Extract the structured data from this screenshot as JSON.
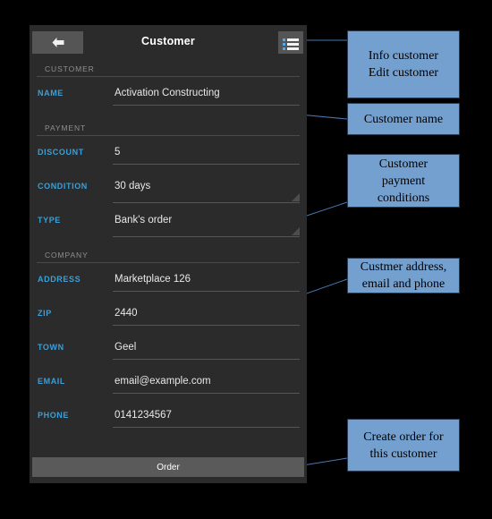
{
  "titlebar": {
    "title": "Customer",
    "back_icon": "arrow-left-icon",
    "menu_icon": "list-menu-icon"
  },
  "sections": [
    {
      "header": "CUSTOMER",
      "fields": [
        {
          "label": "NAME",
          "value": "Activation Constructing",
          "type": "input"
        }
      ]
    },
    {
      "header": "PAYMENT",
      "fields": [
        {
          "label": "DISCOUNT",
          "value": "5",
          "type": "input"
        },
        {
          "label": "CONDITION",
          "value": "30 days",
          "type": "textarea"
        },
        {
          "label": "TYPE",
          "value": "Bank's order",
          "type": "textarea"
        }
      ]
    },
    {
      "header": "COMPANY",
      "fields": [
        {
          "label": "ADDRESS",
          "value": "Marketplace 126",
          "type": "input"
        },
        {
          "label": "ZIP",
          "value": "2440",
          "type": "input"
        },
        {
          "label": "TOWN",
          "value": "Geel",
          "type": "input"
        },
        {
          "label": "EMAIL",
          "value": "email@example.com",
          "type": "input"
        },
        {
          "label": "PHONE",
          "value": "0141234567",
          "type": "input"
        }
      ]
    }
  ],
  "order_button": {
    "label": "Order"
  },
  "callouts": [
    {
      "id": "info",
      "line1": "Info customer",
      "line2": "Edit customer"
    },
    {
      "id": "name",
      "line1": "Customer name",
      "line2": ""
    },
    {
      "id": "payment",
      "line1": "Customer",
      "line2": "payment",
      "line3": "conditions"
    },
    {
      "id": "address",
      "line1": "Custmer address,",
      "line2": "email and phone"
    },
    {
      "id": "order",
      "line1": "Create order for",
      "line2": "this customer"
    }
  ],
  "colors": {
    "panel_background": "#2b2b2b",
    "page_background": "#000000",
    "field_label": "#38a0da",
    "section_header": "#8f8f8f",
    "field_value": "#e8e8e8",
    "button_face": "#555555",
    "order_button": "#5a5a5a",
    "callout_fill": "#74a0d0",
    "callout_border": "#2a3a52",
    "connector_line": "#4a78b0"
  }
}
